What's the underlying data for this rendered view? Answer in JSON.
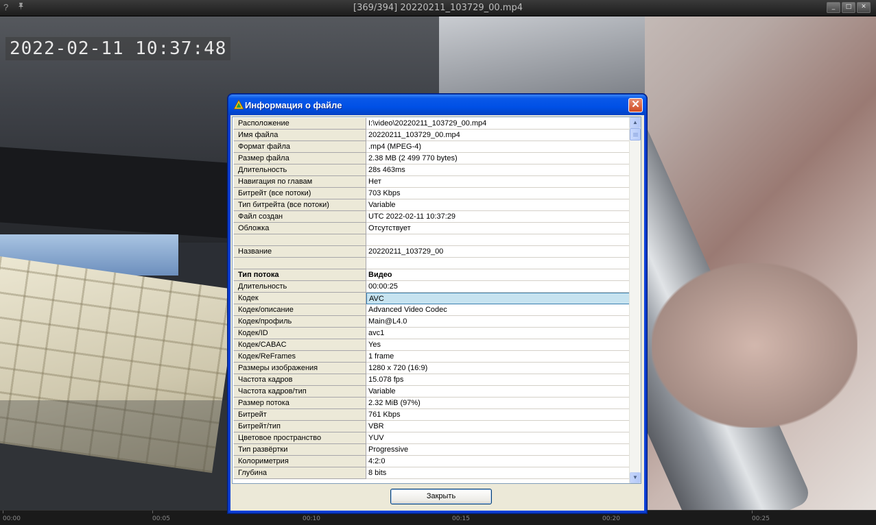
{
  "player": {
    "title": "[369/394] 20220211_103729_00.mp4",
    "help_icon": "?",
    "window_buttons": [
      "_",
      "□",
      "✕"
    ]
  },
  "video": {
    "timestamp": "2022-02-11 10:37:48"
  },
  "timeline": {
    "ticks": [
      "00:00",
      "00:05",
      "00:10",
      "00:15",
      "00:20",
      "00:25"
    ]
  },
  "dialog": {
    "title": "Информация о файле",
    "close_button": "Закрыть",
    "rows": [
      {
        "key": "Расположение",
        "value": "I:\\video\\20220211_103729_00.mp4"
      },
      {
        "key": "Имя файла",
        "value": "20220211_103729_00.mp4"
      },
      {
        "key": "Формат файла",
        "value": ".mp4 (MPEG-4)"
      },
      {
        "key": "Размер файла",
        "value": "2.38 MB (2 499 770 bytes)"
      },
      {
        "key": "Длительность",
        "value": "28s 463ms"
      },
      {
        "key": "Навигация по главам",
        "value": "Нет"
      },
      {
        "key": "Битрейт (все потоки)",
        "value": "703 Kbps"
      },
      {
        "key": "Тип битрейта (все потоки)",
        "value": "Variable"
      },
      {
        "key": "Файл создан",
        "value": "UTC 2022-02-11 10:37:29"
      },
      {
        "key": "Обложка",
        "value": "Отсутствует"
      },
      {
        "key": "",
        "value": ""
      },
      {
        "key": "Название",
        "value": "20220211_103729_00"
      },
      {
        "key": "",
        "value": ""
      },
      {
        "key": "Тип потока",
        "value": "Видео",
        "bold": true
      },
      {
        "key": "Длительность",
        "value": "00:00:25"
      },
      {
        "key": "Кодек",
        "value": "AVC",
        "selected": true
      },
      {
        "key": "Кодек/описание",
        "value": "Advanced Video Codec"
      },
      {
        "key": "Кодек/профиль",
        "value": "Main@L4.0"
      },
      {
        "key": "Кодек/ID",
        "value": "avc1"
      },
      {
        "key": "Кодек/CABAC",
        "value": "Yes"
      },
      {
        "key": "Кодек/ReFrames",
        "value": "1 frame"
      },
      {
        "key": "Размеры изображения",
        "value": "1280 x 720 (16:9)"
      },
      {
        "key": "Частота кадров",
        "value": "15.078 fps"
      },
      {
        "key": "Частота кадров/тип",
        "value": "Variable"
      },
      {
        "key": "Размер потока",
        "value": "2.32 MiB (97%)"
      },
      {
        "key": "Битрейт",
        "value": "761 Kbps"
      },
      {
        "key": "Битрейт/тип",
        "value": "VBR"
      },
      {
        "key": "Цветовое пространство",
        "value": "YUV"
      },
      {
        "key": "Тип развёртки",
        "value": "Progressive"
      },
      {
        "key": "Колориметрия",
        "value": "4:2:0"
      },
      {
        "key": "Глубина",
        "value": "8 bits"
      }
    ]
  },
  "colors": {
    "dialog_title_blue": "#0050e6",
    "selected_cell": "#c6e3f0",
    "close_red": "#cf4a22"
  }
}
